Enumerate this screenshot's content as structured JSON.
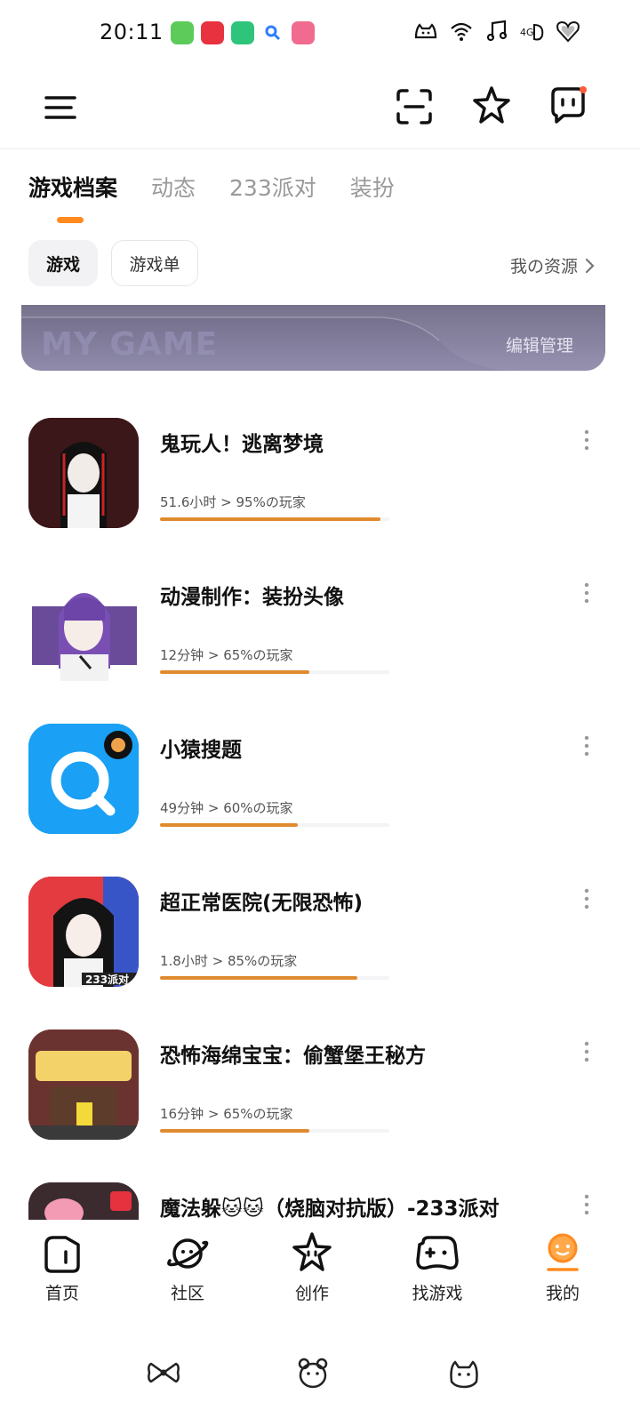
{
  "status_bar": {
    "time": "20:11"
  },
  "tabs": [
    {
      "label": "游戏档案",
      "active": true
    },
    {
      "label": "动态",
      "active": false
    },
    {
      "label": "233派对",
      "active": false
    },
    {
      "label": "装扮",
      "active": false
    }
  ],
  "chips": {
    "games": "游戏",
    "game_list": "游戏单"
  },
  "my_resources": "我の资源",
  "banner": {
    "title": "MY GAME",
    "edit": "编辑管理"
  },
  "games": [
    {
      "name": "鬼玩人！逃离梦境",
      "stats": "51.6小时 > 95%の玩家",
      "progress": 0.96
    },
    {
      "name": "动漫制作：装扮头像",
      "stats": "12分钟 > 65%の玩家",
      "progress": 0.65
    },
    {
      "name": "小猿搜题",
      "stats": "49分钟 > 60%の玩家",
      "progress": 0.6
    },
    {
      "name": "超正常医院(无限恐怖)",
      "stats": "1.8小时 > 85%の玩家",
      "progress": 0.86
    },
    {
      "name": "恐怖海绵宝宝：偷蟹堡王秘方",
      "stats": "16分钟 > 65%の玩家",
      "progress": 0.65
    },
    {
      "name": "魔法躲🐱🐱（烧脑对抗版）-233派对",
      "stats": "",
      "progress": 0
    }
  ],
  "bottom_nav": [
    {
      "label": "首页",
      "icon": "home-icon"
    },
    {
      "label": "社区",
      "icon": "planet-icon"
    },
    {
      "label": "创作",
      "icon": "star-icon"
    },
    {
      "label": "找游戏",
      "icon": "gamepad-icon"
    },
    {
      "label": "我的",
      "icon": "profile-icon",
      "active": true
    }
  ],
  "colors": {
    "accent": "#ff8a1f",
    "progress": "#e08a2e",
    "banner": "#7a7596"
  }
}
